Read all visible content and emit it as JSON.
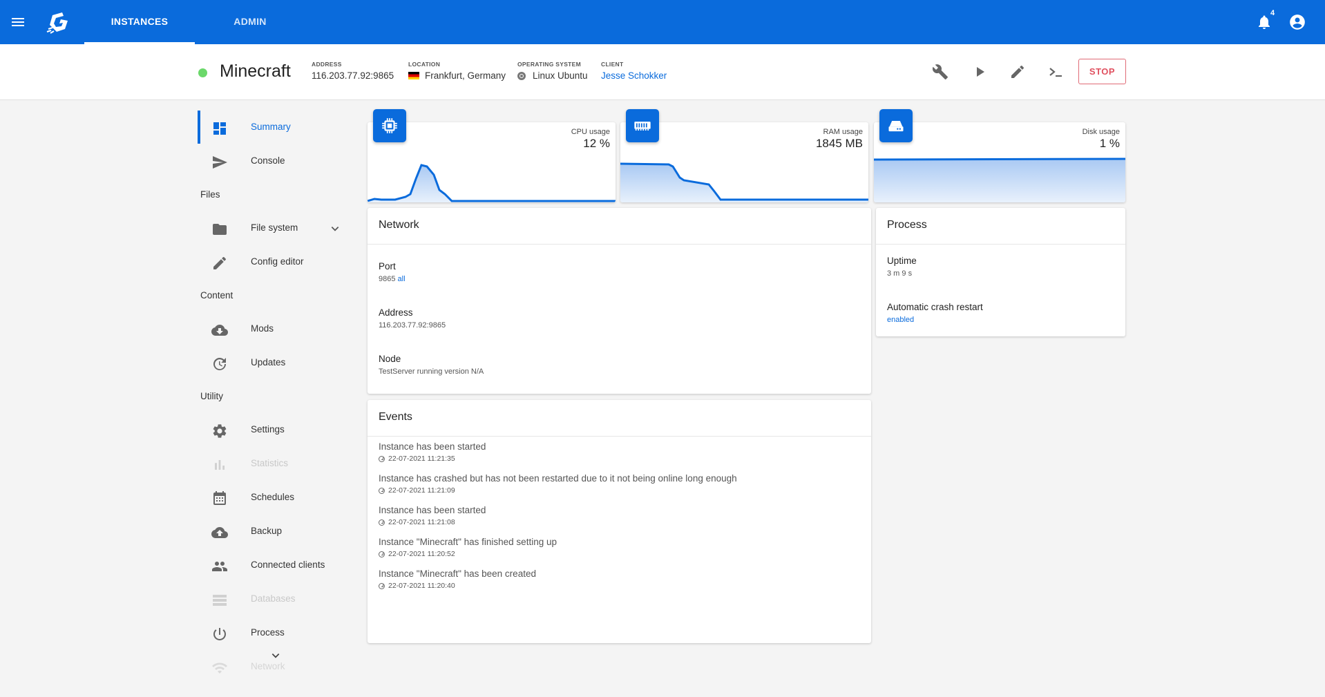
{
  "topbar": {
    "tabs": [
      {
        "label": "INSTANCES",
        "active": true
      },
      {
        "label": "ADMIN",
        "active": false
      }
    ],
    "notification_count": "4",
    "brand_color": "#0a6bdc"
  },
  "instance": {
    "name": "Minecraft",
    "status_color": "#6bd86a",
    "address_label": "ADDRESS",
    "address": "116.203.77.92:9865",
    "location_label": "LOCATION",
    "location": "Frankfurt, Germany",
    "os_label": "OPERATING SYSTEM",
    "os": "Linux Ubuntu",
    "client_label": "CLIENT",
    "client": "Jesse Schokker",
    "stop_label": "STOP",
    "actions": [
      "wrench-icon",
      "play-icon",
      "pencil-icon",
      "terminal-icon"
    ]
  },
  "sidebar": {
    "items": [
      {
        "label": "Summary",
        "icon": "dashboard-icon",
        "active": true
      },
      {
        "label": "Console",
        "icon": "send-icon"
      },
      {
        "section": "Files"
      },
      {
        "label": "File system",
        "icon": "folder-icon",
        "expandable": true
      },
      {
        "label": "Config editor",
        "icon": "pencil-icon"
      },
      {
        "section": "Content"
      },
      {
        "label": "Mods",
        "icon": "cloud-download-icon"
      },
      {
        "label": "Updates",
        "icon": "update-icon"
      },
      {
        "section": "Utility"
      },
      {
        "label": "Settings",
        "icon": "gear-icon"
      },
      {
        "label": "Statistics",
        "icon": "bar-chart-icon",
        "disabled": true
      },
      {
        "label": "Schedules",
        "icon": "calendar-icon"
      },
      {
        "label": "Backup",
        "icon": "cloud-upload-icon"
      },
      {
        "label": "Connected clients",
        "icon": "people-icon"
      },
      {
        "label": "Databases",
        "icon": "database-icon",
        "disabled": true
      },
      {
        "label": "Process",
        "icon": "power-icon"
      },
      {
        "label": "Network",
        "icon": "wifi-icon",
        "disabled": true
      }
    ]
  },
  "stats": {
    "cpu": {
      "label": "CPU usage",
      "value": "12 %",
      "icon": "cpu-icon"
    },
    "ram": {
      "label": "RAM usage",
      "value": "1845 MB",
      "icon": "memory-icon"
    },
    "disk": {
      "label": "Disk usage",
      "value": "1 %",
      "icon": "disk-icon"
    }
  },
  "network": {
    "title": "Network",
    "port_label": "Port",
    "port_value": "9865",
    "port_scope": "all",
    "address_label": "Address",
    "address_value": "116.203.77.92:9865",
    "node_label": "Node",
    "node_value": "TestServer running version N/A"
  },
  "process": {
    "title": "Process",
    "uptime_label": "Uptime",
    "uptime_value": "3 m 9 s",
    "crash_label": "Automatic crash restart",
    "crash_value": "enabled"
  },
  "events": {
    "title": "Events",
    "items": [
      {
        "text": "Instance has been started",
        "time": "22-07-2021 11:21:35"
      },
      {
        "text": "Instance has crashed but has not been restarted due to it not being online long enough",
        "time": "22-07-2021 11:21:09"
      },
      {
        "text": "Instance has been started",
        "time": "22-07-2021 11:21:08"
      },
      {
        "text": "Instance \"Minecraft\" has finished setting up",
        "time": "22-07-2021 11:20:52"
      },
      {
        "text": "Instance \"Minecraft\" has been created",
        "time": "22-07-2021 11:20:40"
      }
    ]
  }
}
